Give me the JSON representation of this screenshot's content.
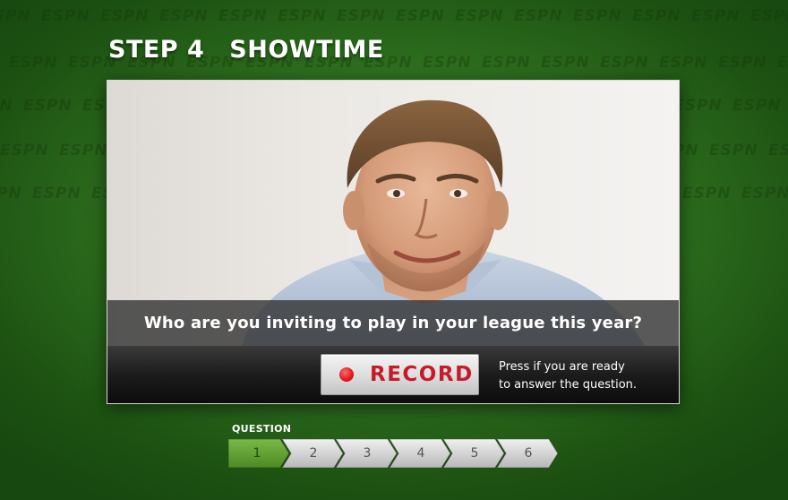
{
  "header": {
    "step": "STEP 4",
    "title": "SHOWTIME"
  },
  "watermark_text": "ESPN",
  "question": {
    "text": "Who are you inviting to play in your league this year?"
  },
  "record": {
    "label": "RECORD",
    "help_line1": "Press if you are ready",
    "help_line2": "to answer the question."
  },
  "progress": {
    "label": "QUESTION",
    "steps": [
      "1",
      "2",
      "3",
      "4",
      "5",
      "6"
    ],
    "active_step": "1"
  },
  "colors": {
    "background_green": "#2f7220",
    "record_red": "#c41b2b",
    "active_step_green": "#6aa53a"
  }
}
